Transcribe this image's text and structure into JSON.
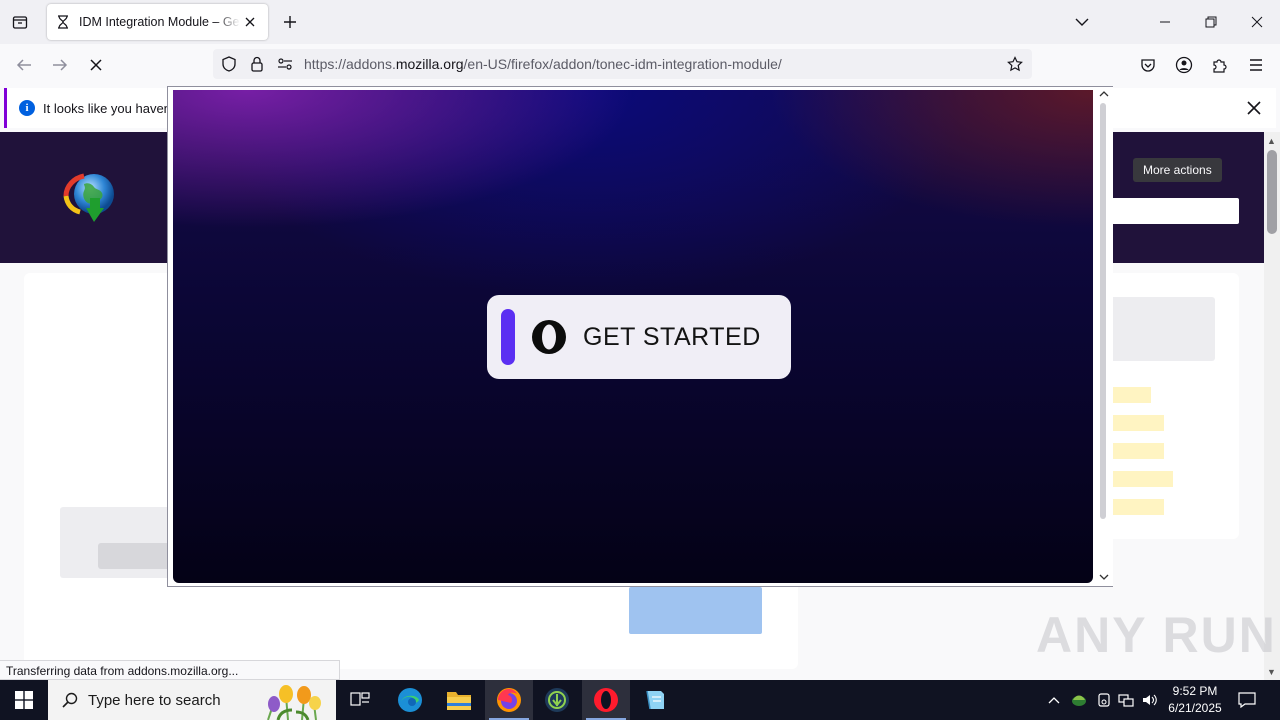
{
  "browser": {
    "tab": {
      "title": "IDM Integration Module – Get this Extension for Firefox"
    },
    "url": {
      "prefix": "https://addons.",
      "host": "mozilla.org",
      "path": "/en-US/firefox/addon/tonec-idm-integration-module/"
    }
  },
  "notification": {
    "text": "It looks like you haven't"
  },
  "page": {
    "tooltip": "More actions",
    "status": "Transferring data from addons.mozilla.org..."
  },
  "popup": {
    "button_label": "GET STARTED"
  },
  "taskbar": {
    "search_placeholder": "Type here to search",
    "time": "9:52 PM",
    "date": "6/21/2025"
  },
  "watermark": "ANY RUN"
}
